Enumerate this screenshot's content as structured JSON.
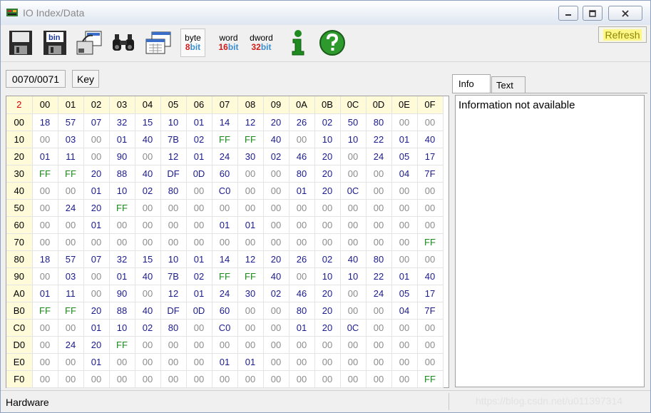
{
  "window": {
    "title": "IO Index/Data",
    "controls": [
      "minimize",
      "restore",
      "close"
    ]
  },
  "toolbar": {
    "buttons": [
      {
        "name": "save",
        "icon": "floppy-disk-icon"
      },
      {
        "name": "save-bin",
        "icon": "floppy-bin-icon",
        "label": "bin"
      },
      {
        "name": "open",
        "icon": "open-device-icon"
      },
      {
        "name": "find",
        "icon": "binoculars-icon"
      },
      {
        "name": "view",
        "icon": "window-grid-icon"
      },
      {
        "name": "byte",
        "top": "byte",
        "bottom_num": "8",
        "bottom_unit": "bit"
      },
      {
        "name": "word",
        "top": "word",
        "bottom_num": "16",
        "bottom_unit": "bit"
      },
      {
        "name": "dword",
        "top": "dword",
        "bottom_num": "32",
        "bottom_unit": "bit"
      },
      {
        "name": "info",
        "icon": "info-icon"
      },
      {
        "name": "help",
        "icon": "help-icon"
      }
    ],
    "refresh_label": "Refresh"
  },
  "index_box": "0070/0071",
  "key_box": "Key",
  "grid": {
    "corner": "2",
    "col_headers": [
      "00",
      "01",
      "02",
      "03",
      "04",
      "05",
      "06",
      "07",
      "08",
      "09",
      "0A",
      "0B",
      "0C",
      "0D",
      "0E",
      "0F"
    ],
    "rows": [
      {
        "h": "00",
        "v": [
          "18",
          "57",
          "07",
          "32",
          "15",
          "10",
          "01",
          "14",
          "12",
          "20",
          "26",
          "02",
          "50",
          "80",
          "00",
          "00"
        ]
      },
      {
        "h": "10",
        "v": [
          "00",
          "03",
          "00",
          "01",
          "40",
          "7B",
          "02",
          "FF",
          "FF",
          "40",
          "00",
          "10",
          "10",
          "22",
          "01",
          "40"
        ]
      },
      {
        "h": "20",
        "v": [
          "01",
          "11",
          "00",
          "90",
          "00",
          "12",
          "01",
          "24",
          "30",
          "02",
          "46",
          "20",
          "00",
          "24",
          "05",
          "17"
        ]
      },
      {
        "h": "30",
        "v": [
          "FF",
          "FF",
          "20",
          "88",
          "40",
          "DF",
          "0D",
          "60",
          "00",
          "00",
          "80",
          "20",
          "00",
          "00",
          "04",
          "7F"
        ]
      },
      {
        "h": "40",
        "v": [
          "00",
          "00",
          "01",
          "10",
          "02",
          "80",
          "00",
          "C0",
          "00",
          "00",
          "01",
          "20",
          "0C",
          "00",
          "00",
          "00"
        ]
      },
      {
        "h": "50",
        "v": [
          "00",
          "24",
          "20",
          "FF",
          "00",
          "00",
          "00",
          "00",
          "00",
          "00",
          "00",
          "00",
          "00",
          "00",
          "00",
          "00"
        ]
      },
      {
        "h": "60",
        "v": [
          "00",
          "00",
          "01",
          "00",
          "00",
          "00",
          "00",
          "01",
          "01",
          "00",
          "00",
          "00",
          "00",
          "00",
          "00",
          "00"
        ]
      },
      {
        "h": "70",
        "v": [
          "00",
          "00",
          "00",
          "00",
          "00",
          "00",
          "00",
          "00",
          "00",
          "00",
          "00",
          "00",
          "00",
          "00",
          "00",
          "FF"
        ]
      },
      {
        "h": "80",
        "v": [
          "18",
          "57",
          "07",
          "32",
          "15",
          "10",
          "01",
          "14",
          "12",
          "20",
          "26",
          "02",
          "40",
          "80",
          "00",
          "00"
        ]
      },
      {
        "h": "90",
        "v": [
          "00",
          "03",
          "00",
          "01",
          "40",
          "7B",
          "02",
          "FF",
          "FF",
          "40",
          "00",
          "10",
          "10",
          "22",
          "01",
          "40"
        ]
      },
      {
        "h": "A0",
        "v": [
          "01",
          "11",
          "00",
          "90",
          "00",
          "12",
          "01",
          "24",
          "30",
          "02",
          "46",
          "20",
          "00",
          "24",
          "05",
          "17"
        ]
      },
      {
        "h": "B0",
        "v": [
          "FF",
          "FF",
          "20",
          "88",
          "40",
          "DF",
          "0D",
          "60",
          "00",
          "00",
          "80",
          "20",
          "00",
          "00",
          "04",
          "7F"
        ]
      },
      {
        "h": "C0",
        "v": [
          "00",
          "00",
          "01",
          "10",
          "02",
          "80",
          "00",
          "C0",
          "00",
          "00",
          "01",
          "20",
          "0C",
          "00",
          "00",
          "00"
        ]
      },
      {
        "h": "D0",
        "v": [
          "00",
          "24",
          "20",
          "FF",
          "00",
          "00",
          "00",
          "00",
          "00",
          "00",
          "00",
          "00",
          "00",
          "00",
          "00",
          "00"
        ]
      },
      {
        "h": "E0",
        "v": [
          "00",
          "00",
          "01",
          "00",
          "00",
          "00",
          "00",
          "01",
          "01",
          "00",
          "00",
          "00",
          "00",
          "00",
          "00",
          "00"
        ]
      },
      {
        "h": "F0",
        "v": [
          "00",
          "00",
          "00",
          "00",
          "00",
          "00",
          "00",
          "00",
          "00",
          "00",
          "00",
          "00",
          "00",
          "00",
          "00",
          "FF"
        ]
      }
    ]
  },
  "tabs": {
    "info": "Info",
    "text": "Text"
  },
  "info_panel": {
    "message": "Information not available"
  },
  "status": {
    "left": "Hardware",
    "watermark": "https://blog.csdn.net/u011397314"
  },
  "colors": {
    "zero": "#8c8c8c",
    "ff": "#1a8a1a",
    "value": "#1b1b8c",
    "header_bg": "#fffbd8",
    "corner": "#d00000"
  }
}
